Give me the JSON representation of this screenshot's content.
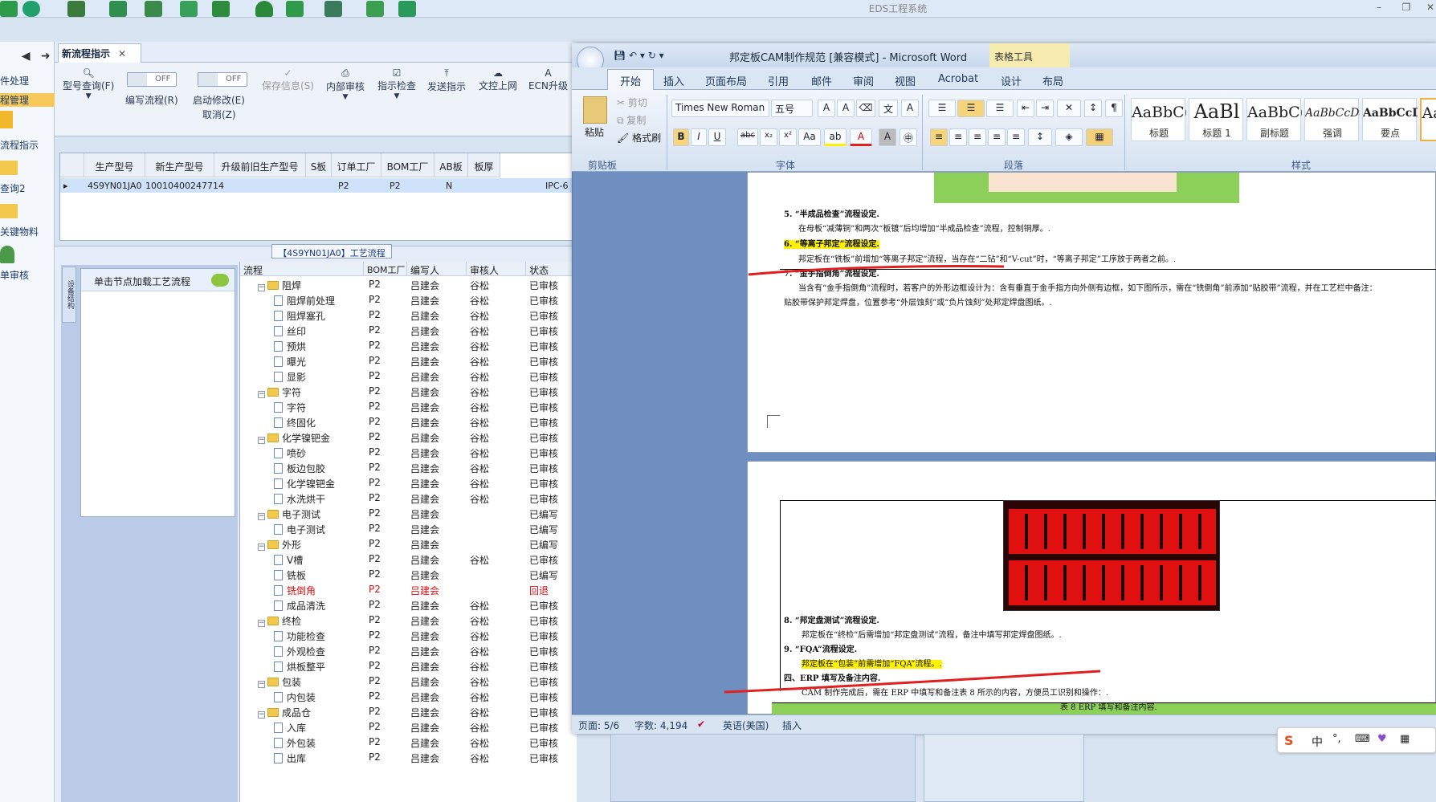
{
  "app": {
    "title": "EDS工程系统"
  },
  "left_nav": [
    "件处理",
    "程管理",
    "流程指示",
    "查询2",
    "关键物料",
    "单审核"
  ],
  "tab": {
    "label": "新流程指示"
  },
  "toolbar": {
    "model_query": "型号查询(F)",
    "edit_flow": "编写流程(R)",
    "start_modify": "启动修改(E)",
    "cancel_z": "取消(Z)",
    "save_info": "保存信息(S)",
    "internal_review": "内部审核",
    "check": "指示检查",
    "send": "发送指示",
    "upload": "文控上网",
    "ecn": "ECN升级",
    "off1": "OFF",
    "off2": "OFF"
  },
  "grid1": {
    "headers": [
      "生产型号",
      "新生产型号",
      "升级前旧生产型号",
      "S板",
      "订单工厂",
      "BOM工厂",
      "AB板",
      "板厚",
      "板材"
    ],
    "row": {
      "model": "4S9YN01JA0",
      "new_model": "10010400247714",
      "order_factory": "P2",
      "bom_factory": "P2",
      "ab": "N",
      "material": "IPC-6"
    }
  },
  "process_title": "【4S9YN01JA0】工艺流程",
  "side": {
    "vtab": "设备结构",
    "node_hint": "单击节点加载工艺流程"
  },
  "tree": {
    "headers": [
      "流程",
      "BOM工厂",
      "编写人",
      "审核人",
      "状态"
    ],
    "rows": [
      {
        "name": "阻焊",
        "level": 0,
        "bom": "P2",
        "writer": "吕建会",
        "reviewer": "谷松",
        "status": "已审核"
      },
      {
        "name": "阻焊前处理",
        "level": 1,
        "bom": "P2",
        "writer": "吕建会",
        "reviewer": "谷松",
        "status": "已审核"
      },
      {
        "name": "阻焊塞孔",
        "level": 1,
        "bom": "P2",
        "writer": "吕建会",
        "reviewer": "谷松",
        "status": "已审核"
      },
      {
        "name": "丝印",
        "level": 1,
        "bom": "P2",
        "writer": "吕建会",
        "reviewer": "谷松",
        "status": "已审核"
      },
      {
        "name": "预烘",
        "level": 1,
        "bom": "P2",
        "writer": "吕建会",
        "reviewer": "谷松",
        "status": "已审核"
      },
      {
        "name": "曝光",
        "level": 1,
        "bom": "P2",
        "writer": "吕建会",
        "reviewer": "谷松",
        "status": "已审核"
      },
      {
        "name": "显影",
        "level": 1,
        "bom": "P2",
        "writer": "吕建会",
        "reviewer": "谷松",
        "status": "已审核"
      },
      {
        "name": "字符",
        "level": 0,
        "bom": "P2",
        "writer": "吕建会",
        "reviewer": "谷松",
        "status": "已审核"
      },
      {
        "name": "字符",
        "level": 1,
        "bom": "P2",
        "writer": "吕建会",
        "reviewer": "谷松",
        "status": "已审核"
      },
      {
        "name": "终固化",
        "level": 1,
        "bom": "P2",
        "writer": "吕建会",
        "reviewer": "谷松",
        "status": "已审核"
      },
      {
        "name": "化学镍钯金",
        "level": 0,
        "bom": "P2",
        "writer": "吕建会",
        "reviewer": "谷松",
        "status": "已审核"
      },
      {
        "name": "喷砂",
        "level": 1,
        "bom": "P2",
        "writer": "吕建会",
        "reviewer": "谷松",
        "status": "已审核"
      },
      {
        "name": "板边包胶",
        "level": 1,
        "bom": "P2",
        "writer": "吕建会",
        "reviewer": "谷松",
        "status": "已审核"
      },
      {
        "name": "化学镍钯金",
        "level": 1,
        "bom": "P2",
        "writer": "吕建会",
        "reviewer": "谷松",
        "status": "已审核"
      },
      {
        "name": "水洗烘干",
        "level": 1,
        "bom": "P2",
        "writer": "吕建会",
        "reviewer": "谷松",
        "status": "已审核"
      },
      {
        "name": "电子测试",
        "level": 0,
        "bom": "P2",
        "writer": "吕建会",
        "reviewer": "",
        "status": "已编写"
      },
      {
        "name": "电子测试",
        "level": 1,
        "bom": "P2",
        "writer": "吕建会",
        "reviewer": "",
        "status": "已编写"
      },
      {
        "name": "外形",
        "level": 0,
        "bom": "P2",
        "writer": "吕建会",
        "reviewer": "",
        "status": "已编写"
      },
      {
        "name": "V槽",
        "level": 1,
        "bom": "P2",
        "writer": "吕建会",
        "reviewer": "谷松",
        "status": "已审核"
      },
      {
        "name": "铣板",
        "level": 1,
        "bom": "P2",
        "writer": "吕建会",
        "reviewer": "",
        "status": "已编写"
      },
      {
        "name": "铣倒角",
        "level": 1,
        "bom": "P2",
        "writer": "吕建会",
        "reviewer": "",
        "status": "回退",
        "red": true
      },
      {
        "name": "成品清洗",
        "level": 1,
        "bom": "P2",
        "writer": "吕建会",
        "reviewer": "谷松",
        "status": "已审核"
      },
      {
        "name": "终检",
        "level": 0,
        "bom": "P2",
        "writer": "吕建会",
        "reviewer": "谷松",
        "status": "已审核"
      },
      {
        "name": "功能检查",
        "level": 1,
        "bom": "P2",
        "writer": "吕建会",
        "reviewer": "谷松",
        "status": "已审核"
      },
      {
        "name": "外观检查",
        "level": 1,
        "bom": "P2",
        "writer": "吕建会",
        "reviewer": "谷松",
        "status": "已审核"
      },
      {
        "name": "烘板整平",
        "level": 1,
        "bom": "P2",
        "writer": "吕建会",
        "reviewer": "谷松",
        "status": "已审核"
      },
      {
        "name": "包装",
        "level": 0,
        "bom": "P2",
        "writer": "吕建会",
        "reviewer": "谷松",
        "status": "已审核"
      },
      {
        "name": "内包装",
        "level": 1,
        "bom": "P2",
        "writer": "吕建会",
        "reviewer": "谷松",
        "status": "已审核"
      },
      {
        "name": "成品仓",
        "level": 0,
        "bom": "P2",
        "writer": "吕建会",
        "reviewer": "谷松",
        "status": "已审核"
      },
      {
        "name": "入库",
        "level": 1,
        "bom": "P2",
        "writer": "吕建会",
        "reviewer": "谷松",
        "status": "已审核"
      },
      {
        "name": "外包装",
        "level": 1,
        "bom": "P2",
        "writer": "吕建会",
        "reviewer": "谷松",
        "status": "已审核"
      },
      {
        "name": "出库",
        "level": 1,
        "bom": "P2",
        "writer": "吕建会",
        "reviewer": "谷松",
        "status": "已审核"
      }
    ]
  },
  "word": {
    "title": "邦定板CAM制作规范 [兼容模式] - Microsoft Word",
    "table_tools": "表格工具",
    "tabs": [
      "开始",
      "插入",
      "页面布局",
      "引用",
      "邮件",
      "审阅",
      "视图",
      "Acrobat",
      "设计",
      "布局"
    ],
    "clipboard": {
      "paste": "粘贴",
      "cut": "剪切",
      "copy": "复制",
      "format_painter": "格式刷",
      "label": "剪贴板"
    },
    "font": {
      "name": "Times New Roman",
      "size": "五号",
      "label": "字体"
    },
    "paragraph": {
      "label": "段落"
    },
    "styles": {
      "label": "样式",
      "items": [
        {
          "sample": "AaBbC(",
          "name": "标题"
        },
        {
          "sample": "AaBl",
          "name": "标题 1"
        },
        {
          "sample": "AaBbC(",
          "name": "副标题"
        },
        {
          "sample": "AaBbCcDd",
          "name": "强调"
        },
        {
          "sample": "AaBbCcD",
          "name": "要点"
        },
        {
          "sample": "AaB",
          "name": ""
        }
      ]
    },
    "doc": {
      "p1_l1": "5. “半成品检查”流程设定.",
      "p1_l2": "在母板“减薄铜”和两次“板镀”后均增加“半成品检查”流程，控制铜厚。.",
      "p1_l3": "6. “等离子邦定”流程设定.",
      "p1_l4": "邦定板在“铣板”前增加“等离子邦定”流程，当存在“二钻”和“V-cut”时，“等离子邦定”工序放于两者之前。.",
      "p1_l5": "7. “金手指倒角”流程设定.",
      "p1_l6": "当含有“金手指倒角”流程时，若客户的外形边框设计为：含有垂直于金手指方向外侧有边框，如下图所示，需在“铣倒角”前添加“贴胶带”流程，并在工艺栏中备注：",
      "p1_l7": "贴胶带保护邦定焊盘，位置参考“外层蚀刻”或“负片蚀刻”处邦定焊盘图纸。.",
      "p2_l1": "8. “邦定盘测试”流程设定.",
      "p2_l2": "邦定板在“终检”后需增加“邦定盘测试”流程，备注中填写邦定焊盘图纸。.",
      "p2_l3": "9. “FQA”流程设定.",
      "p2_l4": "邦定板在“包装”前需增加“FQA”流程。.",
      "p2_l5": "四、ERP 填写及备注内容.",
      "p2_l6": "CAM 制作完成后，需在 ERP 中填写和备注表 8 所示的内容，方便员工识别和操作：.",
      "p2_l7": "表 8 ERP 填写和备注内容."
    },
    "status": {
      "page": "页面: 5/6",
      "words": "字数: 4,194",
      "lang": "英语(美国)",
      "mode": "插入"
    }
  },
  "ime": {
    "cn": "中"
  },
  "colors": {
    "accent": "#1e395b",
    "highlight": "#fff200",
    "red_pen": "#e02020",
    "green_block": "#8cd05a"
  }
}
